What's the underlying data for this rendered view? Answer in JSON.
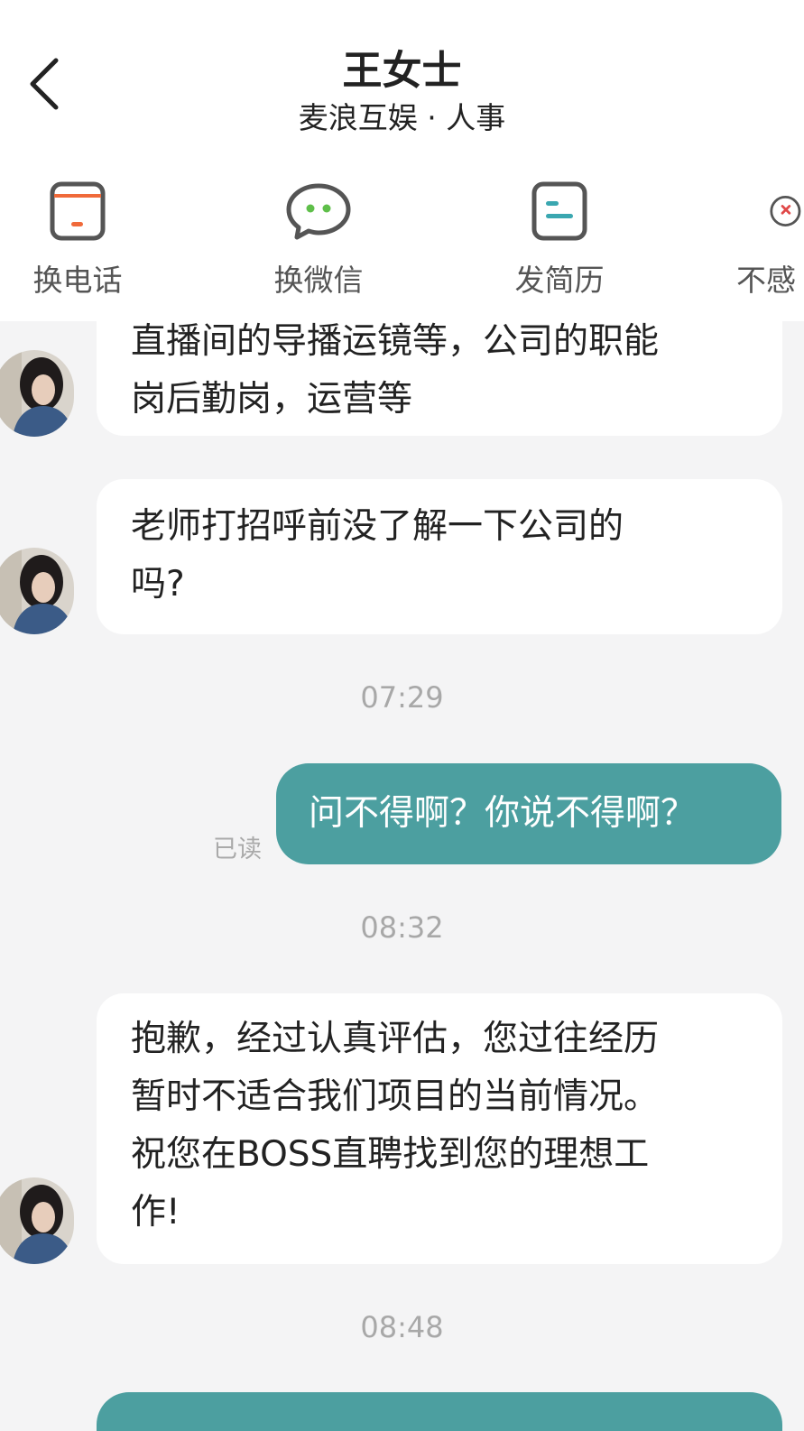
{
  "header": {
    "title": "王女士",
    "subtitle": "麦浪互娱 · 人事",
    "actions": [
      {
        "label": "换电话",
        "icon": "phone-icon"
      },
      {
        "label": "换微信",
        "icon": "wechat-icon"
      },
      {
        "label": "发简历",
        "icon": "resume-icon"
      },
      {
        "label": "不感",
        "icon": "not-interested-icon"
      }
    ]
  },
  "messages": {
    "m1": {
      "line1": "直播间的导播运镜等，公司的职能",
      "line2": "岗后勤岗，运营等"
    },
    "m2": {
      "line1": "老师打招呼前没了解一下公司的",
      "line2": "吗?"
    },
    "t1": "07:29",
    "m3": {
      "text": "问不得啊？你说不得啊？",
      "status": "已读"
    },
    "t2": "08:32",
    "m4": {
      "line1": "抱歉，经过认真评估，您过往经历",
      "line2": "暂时不适合我们项目的当前情况。",
      "line3": "祝您在BOSS直聘找到您的理想工",
      "line4": "作!"
    },
    "t3": "08:48"
  },
  "colors": {
    "accent": "#4c9fa0",
    "phone": "#f06a3a",
    "wechat": "#5fbf4a",
    "resume": "#3aa7b0",
    "danger": "#e04848"
  }
}
